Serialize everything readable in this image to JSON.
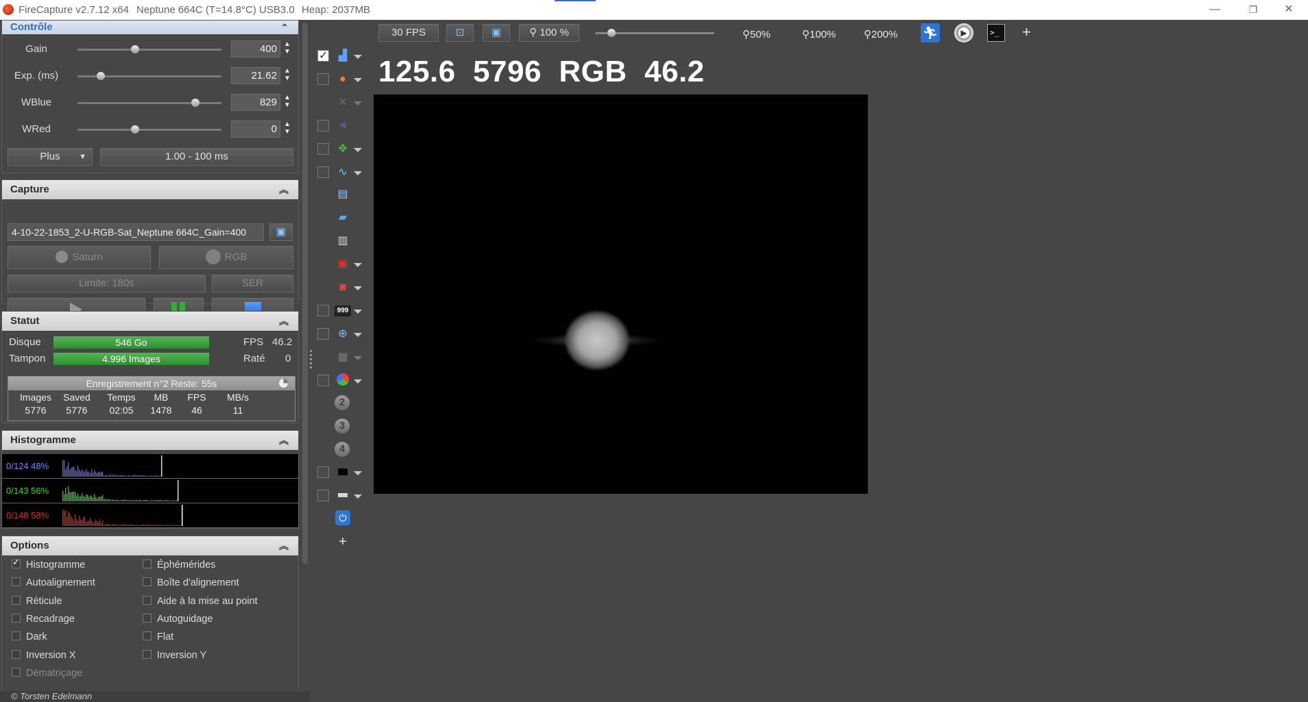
{
  "titlebar": {
    "app": "FireCapture v2.7.12 x64",
    "camera": "Neptune 664C (T=14.8°C) USB3.0",
    "heap": "Heap: 2037MB",
    "minimize": "—",
    "restore": "❐",
    "close": "✕"
  },
  "controle": {
    "title": "Contrôle",
    "gain": {
      "label": "Gain",
      "value": "400",
      "level": 0.4
    },
    "exp": {
      "label": "Exp. (ms)",
      "value": "21.62",
      "level": 0.16
    },
    "wblue": {
      "label": "WBlue",
      "value": "829",
      "level": 0.82
    },
    "wred": {
      "label": "WRed",
      "value": "0",
      "level": 0.4
    },
    "preset": "Plus",
    "range": "1.00 - 100 ms"
  },
  "capture": {
    "title": "Capture",
    "filename": "4-10-22-1853_2-U-RGB-Sat_Neptune 664C_Gain=400",
    "object_label": "Saturn",
    "filter_label": "RGB",
    "limit_label": "Limite: 180s",
    "format_label": "SER"
  },
  "statut": {
    "title": "Statut",
    "disk_label": "Disque",
    "disk_value": "546 Go",
    "buffer_label": "Tampon",
    "buffer_value": "4.996 Images",
    "fps_label": "FPS",
    "fps_value": "46.2",
    "missed_label": "Raté",
    "missed_value": "0",
    "record_label": "Enregistrement n°2   Reste: 55s",
    "columns": [
      "Images",
      "Saved",
      "Temps",
      "MB",
      "FPS",
      "MB/s"
    ],
    "values": [
      "5776",
      "5776",
      "02:05",
      "1478",
      "46",
      "11"
    ]
  },
  "histogramme": {
    "title": "Histogramme",
    "blue": "0/124 48%",
    "green": "0/143 56%",
    "red": "0/148 58%",
    "blue_level": 0.48,
    "green_level": 0.56,
    "red_level": 0.58,
    "colors": {
      "blue": "#5a63ff",
      "green": "#2ecc2e",
      "red": "#e02020"
    }
  },
  "options": {
    "title": "Options",
    "left": [
      "Histogramme",
      "Autoalignement",
      "Réticule",
      "Recadrage",
      "Dark",
      "Inversion X",
      "Dématriçage"
    ],
    "right": [
      "Éphémérides",
      "Boîte d'alignement",
      "Aide à la mise au point",
      "Autoguidage",
      "Flat",
      "Inversion Y"
    ]
  },
  "footer": "© Torsten Edelmann",
  "toolbar": {
    "fps_button": "30 FPS",
    "zoom_button": "100 %",
    "zoom_50": "50%",
    "zoom_100": "100%",
    "zoom_200": "200%",
    "add": "+"
  },
  "readout": "125.6  5796  RGB  46.2",
  "toolcol": {
    "num2": "2",
    "num3": "3",
    "num4": "4",
    "counter": "999",
    "add": "+"
  }
}
